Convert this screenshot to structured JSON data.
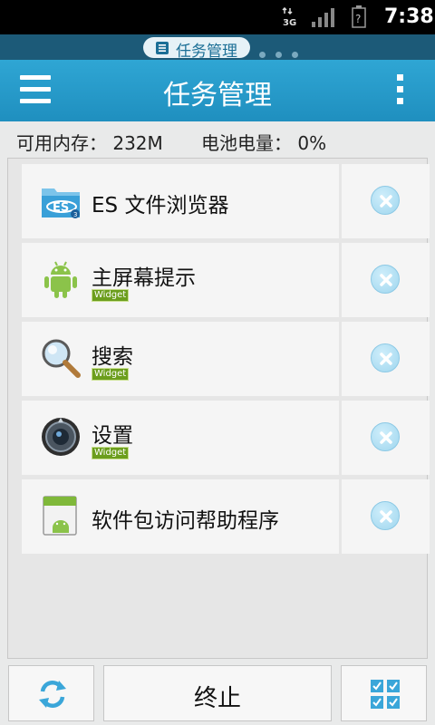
{
  "status_bar": {
    "network": "3G",
    "time": "7:38",
    "battery_indicator": "?"
  },
  "page_indicator": {
    "label": "任务管理",
    "icon": "list-icon",
    "dots": 3
  },
  "header": {
    "title": "任务管理",
    "menu_icon": "hamburger-menu-icon",
    "more_icon": "overflow-menu-icon"
  },
  "info": {
    "memory_label": "可用内存：",
    "memory_value": "232M",
    "battery_label": "电池电量：",
    "battery_value": "0%"
  },
  "tasks": [
    {
      "name": "ES 文件浏览器",
      "badge": "",
      "icon": "es-file-explorer-icon"
    },
    {
      "name": "主屏幕提示",
      "badge": "Widget",
      "icon": "android-robot-icon"
    },
    {
      "name": "搜索",
      "badge": "Widget",
      "icon": "search-magnifier-icon"
    },
    {
      "name": "设置",
      "badge": "Widget",
      "icon": "settings-dial-icon"
    },
    {
      "name": "软件包访问帮助程序",
      "badge": "",
      "icon": "package-android-icon"
    }
  ],
  "bottom_bar": {
    "refresh_icon": "refresh-icon",
    "stop_label": "终止",
    "select_icon": "select-all-checkbox-icon"
  },
  "colors": {
    "header": "#2399c9",
    "strip": "#1c5a78",
    "badge": "#6c9e1d"
  }
}
